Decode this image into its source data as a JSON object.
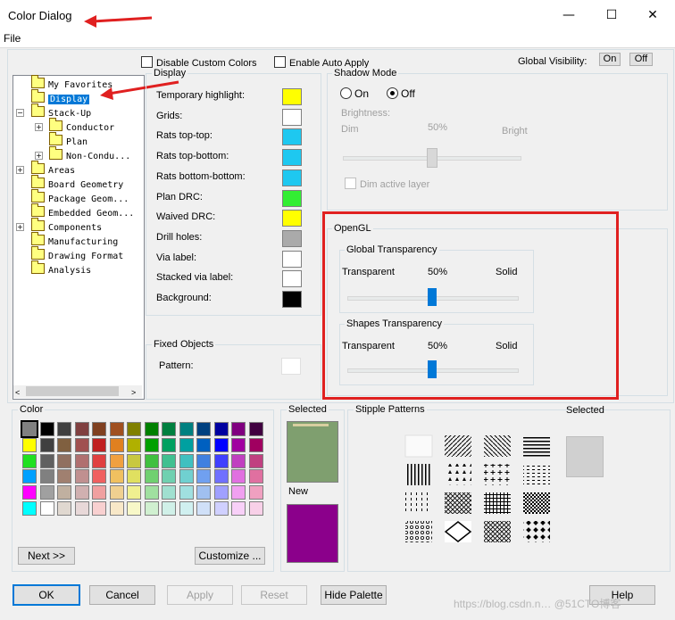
{
  "window": {
    "title": "Color Dialog",
    "minimize": "—",
    "maximize": "☐",
    "close": "✕"
  },
  "menu": {
    "file": "File"
  },
  "tree": {
    "items": [
      {
        "label": "My Favorites"
      },
      {
        "label": "Display",
        "selected": true
      },
      {
        "label": "Stack-Up"
      },
      {
        "label": "Conductor"
      },
      {
        "label": "Plan"
      },
      {
        "label": "Non-Condu..."
      },
      {
        "label": "Areas"
      },
      {
        "label": "Board Geometry"
      },
      {
        "label": "Package Geom..."
      },
      {
        "label": "Embedded Geom..."
      },
      {
        "label": "Components"
      },
      {
        "label": "Manufacturing"
      },
      {
        "label": "Drawing Format"
      },
      {
        "label": "Analysis"
      }
    ]
  },
  "top": {
    "disable_custom_colors": "Disable Custom Colors",
    "enable_auto_apply": "Enable Auto Apply",
    "global_visibility": "Global Visibility:",
    "on": "On",
    "off": "Off"
  },
  "display": {
    "title": "Display",
    "rows": [
      {
        "label": "Temporary highlight:",
        "color": "#ffff00"
      },
      {
        "label": "Grids:",
        "color": "#ffffff"
      },
      {
        "label": "Rats top-top:",
        "color": "#1ec8f0"
      },
      {
        "label": "Rats top-bottom:",
        "color": "#1ec8f0"
      },
      {
        "label": "Rats bottom-bottom:",
        "color": "#1ec8f0"
      },
      {
        "label": "Plan DRC:",
        "color": "#33ee33"
      },
      {
        "label": "Waived DRC:",
        "color": "#ffff00"
      },
      {
        "label": "Drill holes:",
        "color": "#aaaaaa"
      },
      {
        "label": "Via label:",
        "color": "#ffffff"
      },
      {
        "label": "Stacked via label:",
        "color": "#ffffff"
      },
      {
        "label": "Background:",
        "color": "#000000"
      }
    ]
  },
  "fixed_objects": {
    "title": "Fixed Objects",
    "pattern": "Pattern:"
  },
  "shadow": {
    "title": "Shadow Mode",
    "on": "On",
    "off": "Off",
    "selected": "Off",
    "brightness": "Brightness:",
    "dim": "Dim",
    "pct": "50%",
    "bright": "Bright",
    "dim_active_layer": "Dim active layer",
    "level": 0.5
  },
  "opengl": {
    "title": "OpenGL",
    "global": {
      "title": "Global Transparency",
      "left": "Transparent",
      "mid": "50%",
      "right": "Solid",
      "level": 0.5
    },
    "shapes": {
      "title": "Shapes Transparency",
      "left": "Transparent",
      "mid": "50%",
      "right": "Solid",
      "level": 0.5
    }
  },
  "color": {
    "title": "Color",
    "palette": [
      [
        "#808080",
        "#000000",
        "#404040",
        "#804040",
        "#804020",
        "#a05020",
        "#808000",
        "#008000",
        "#008040",
        "#008080",
        "#004080",
        "#0000a0",
        "#800080",
        "#400040"
      ],
      [
        "#ffff00",
        "#404040",
        "#806040",
        "#a05050",
        "#c02020",
        "#e08020",
        "#b0b000",
        "#00a000",
        "#00a060",
        "#00a0a0",
        "#0060c0",
        "#0000ff",
        "#a000a0",
        "#a00060"
      ],
      [
        "#20e020",
        "#606060",
        "#907060",
        "#b07070",
        "#e04040",
        "#f0a040",
        "#c8c840",
        "#40c040",
        "#40c090",
        "#40c0c0",
        "#4080e0",
        "#4040ff",
        "#c040c0",
        "#c04080"
      ],
      [
        "#00a0ff",
        "#808080",
        "#a08070",
        "#c09090",
        "#f06060",
        "#f0c060",
        "#e0e060",
        "#70d070",
        "#70d0b0",
        "#70d0d0",
        "#70a0f0",
        "#7070ff",
        "#e070e0",
        "#e070a0"
      ],
      [
        "#ff00ff",
        "#a0a0a0",
        "#c0b0a0",
        "#d0b0b0",
        "#f0a0a0",
        "#f0d090",
        "#f0f090",
        "#a0e0a0",
        "#a0e0d0",
        "#a0e0e0",
        "#a0c0f0",
        "#a0a0ff",
        "#f0a0f0",
        "#f0a0c0"
      ],
      [
        "#00ffff",
        "#ffffff",
        "#e0d8d0",
        "#e8d8d8",
        "#f8d0d0",
        "#f8e8c8",
        "#f8f8c8",
        "#d0f0d0",
        "#d0f0e8",
        "#d0f0f0",
        "#d0e0f8",
        "#d0d0ff",
        "#f8d0f8",
        "#f8d0e8"
      ]
    ],
    "next": "Next >>",
    "customize": "Customize ..."
  },
  "selected_panel": {
    "title": "Selected",
    "selected_color": "#7f9f6f",
    "new": "New",
    "new_color": "#8b008b"
  },
  "stipple": {
    "title": "Stipple Patterns",
    "selected": "Selected"
  },
  "buttons": {
    "ok": "OK",
    "cancel": "Cancel",
    "apply": "Apply",
    "reset": "Reset",
    "hide_palette": "Hide Palette",
    "help": "Help"
  },
  "watermark": "https://blog.csdn.n… @51CTO博客"
}
